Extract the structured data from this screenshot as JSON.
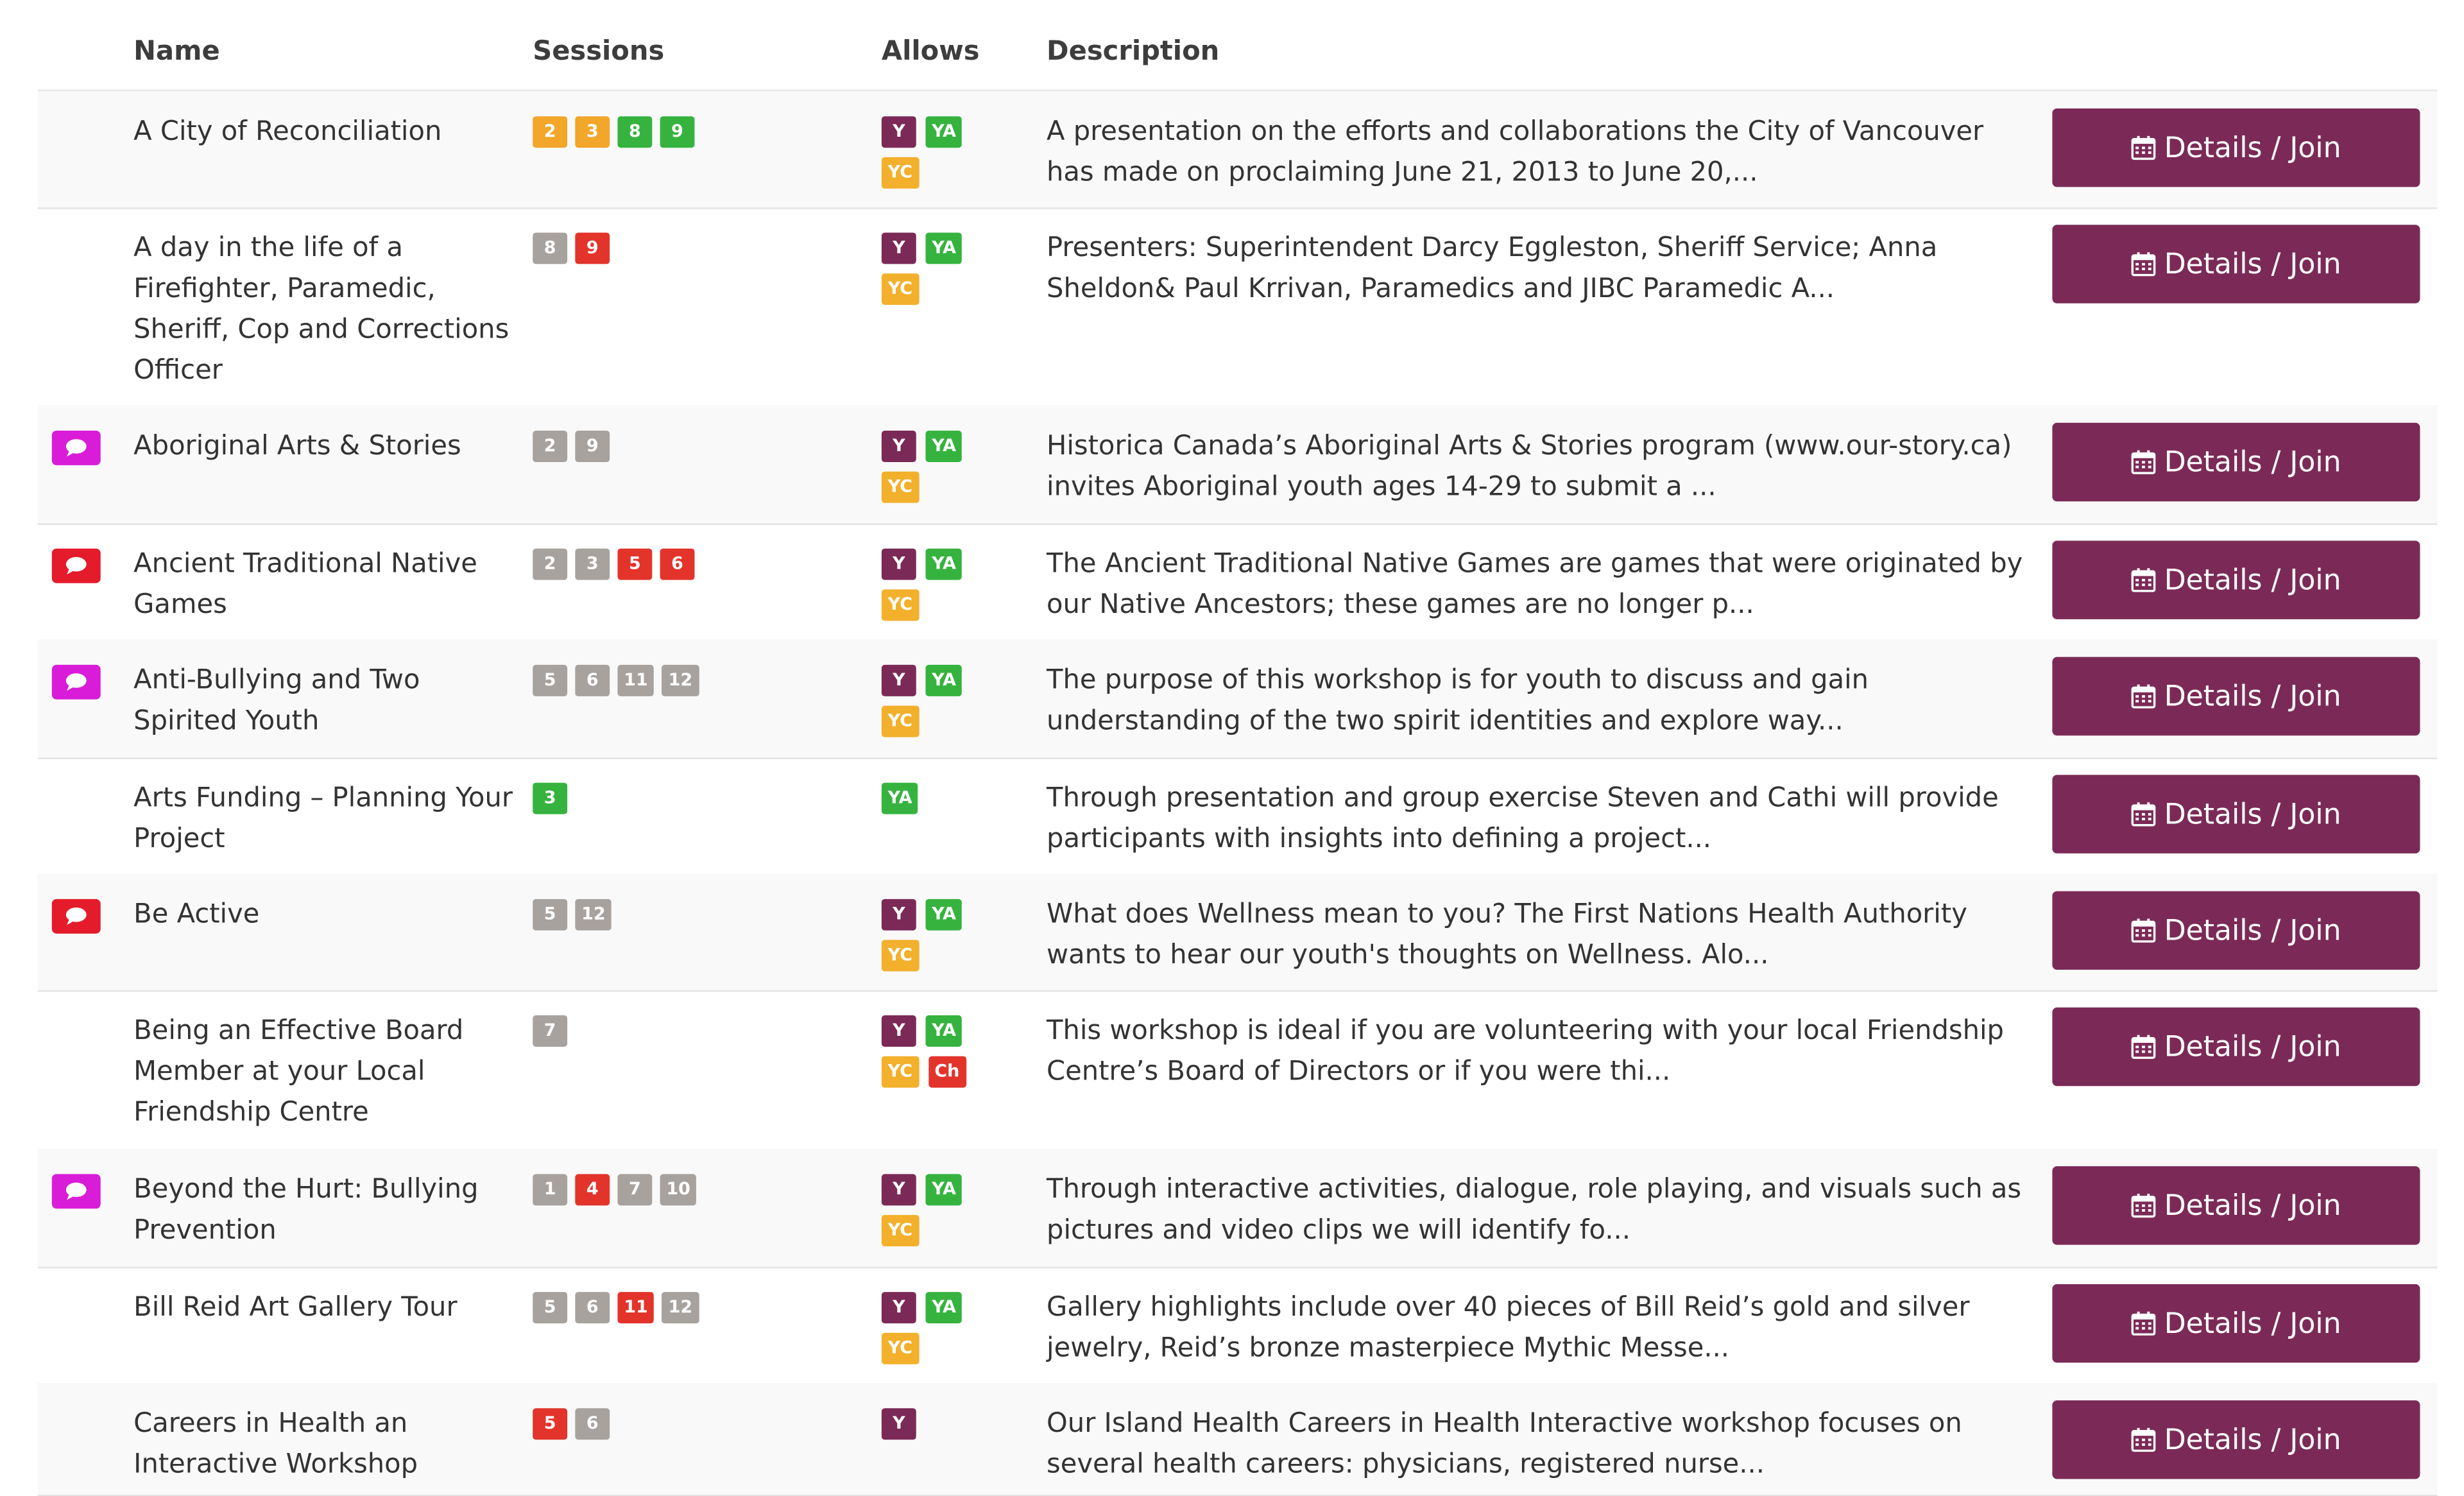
{
  "header": {
    "name": "Name",
    "sessions": "Sessions",
    "allows": "Allows",
    "description": "Description"
  },
  "colors": {
    "button": "#7b2a57",
    "comment_magenta": "#d81cd8",
    "comment_red": "#e41b2a",
    "badge_gray": "#a8a29e",
    "badge_orange": "#f2a62a",
    "badge_green": "#36b33f",
    "badge_red": "#e2342b",
    "allow_Y": "#7b2a57",
    "allow_YA": "#36b33f",
    "allow_YC": "#f2b02c",
    "allow_Ch": "#e2342b"
  },
  "button_label": "Details / Join",
  "rows": [
    {
      "name": "A City of Reconciliation",
      "comment": null,
      "sessions": [
        {
          "n": "2",
          "c": "orange"
        },
        {
          "n": "3",
          "c": "orange"
        },
        {
          "n": "8",
          "c": "green"
        },
        {
          "n": "9",
          "c": "green"
        }
      ],
      "allows": [
        [
          "Y",
          "YA"
        ],
        [
          "YC"
        ]
      ],
      "description": "A presentation on the efforts and collaborations the City of Vancouver has made on proclaiming June 21, 2013 to June 20,..."
    },
    {
      "name": "A day in the life of a Firefighter, Paramedic, Sheriff, Cop and Corrections Officer",
      "comment": null,
      "sessions": [
        {
          "n": "8",
          "c": "gray"
        },
        {
          "n": "9",
          "c": "red"
        }
      ],
      "allows": [
        [
          "Y",
          "YA"
        ],
        [
          "YC"
        ]
      ],
      "description": "Presenters: Superintendent Darcy Eggleston, Sheriff Service; Anna Sheldon& Paul Krrivan, Paramedics and JIBC Paramedic A..."
    },
    {
      "name": "Aboriginal Arts & Stories",
      "comment": "magenta",
      "sessions": [
        {
          "n": "2",
          "c": "gray"
        },
        {
          "n": "9",
          "c": "gray"
        }
      ],
      "allows": [
        [
          "Y",
          "YA"
        ],
        [
          "YC"
        ]
      ],
      "description": "Historica Canada’s Aboriginal Arts & Stories program (www.our-story.ca) invites Aboriginal youth ages 14-29 to submit a ..."
    },
    {
      "name": "Ancient Traditional Native Games",
      "comment": "red",
      "sessions": [
        {
          "n": "2",
          "c": "gray"
        },
        {
          "n": "3",
          "c": "gray"
        },
        {
          "n": "5",
          "c": "red"
        },
        {
          "n": "6",
          "c": "red"
        }
      ],
      "allows": [
        [
          "Y",
          "YA"
        ],
        [
          "YC"
        ]
      ],
      "description": "The Ancient Traditional Native Games are games that were originated by our Native Ancestors; these games are no longer p..."
    },
    {
      "name": "Anti-Bullying and Two Spirited Youth",
      "comment": "magenta",
      "sessions": [
        {
          "n": "5",
          "c": "gray"
        },
        {
          "n": "6",
          "c": "gray"
        },
        {
          "n": "11",
          "c": "gray"
        },
        {
          "n": "12",
          "c": "gray"
        }
      ],
      "allows": [
        [
          "Y",
          "YA"
        ],
        [
          "YC"
        ]
      ],
      "description": "The purpose of this workshop is for youth to discuss and gain understanding of the two spirit identities and explore way..."
    },
    {
      "name": "Arts Funding – Planning Your Project",
      "comment": null,
      "sessions": [
        {
          "n": "3",
          "c": "green"
        }
      ],
      "allows": [
        [
          "YA"
        ]
      ],
      "description": "Through presentation and group exercise Steven and Cathi will provide participants with insights into defining a project..."
    },
    {
      "name": "Be Active",
      "comment": "red",
      "sessions": [
        {
          "n": "5",
          "c": "gray"
        },
        {
          "n": "12",
          "c": "gray"
        }
      ],
      "allows": [
        [
          "Y",
          "YA"
        ],
        [
          "YC"
        ]
      ],
      "description": "What does Wellness mean to you? The First Nations Health Authority wants to hear our youth's thoughts on Wellness. Alo..."
    },
    {
      "name": "Being an Effective Board Member at your Local Friendship Centre",
      "comment": null,
      "sessions": [
        {
          "n": "7",
          "c": "gray"
        }
      ],
      "allows": [
        [
          "Y",
          "YA"
        ],
        [
          "YC",
          "Ch"
        ]
      ],
      "description": "This workshop is ideal if you are volunteering with your local Friendship Centre’s Board of Directors or if you were thi..."
    },
    {
      "name": "Beyond the Hurt: Bullying Prevention",
      "comment": "magenta",
      "sessions": [
        {
          "n": "1",
          "c": "gray"
        },
        {
          "n": "4",
          "c": "red"
        },
        {
          "n": "7",
          "c": "gray"
        },
        {
          "n": "10",
          "c": "gray"
        }
      ],
      "allows": [
        [
          "Y",
          "YA"
        ],
        [
          "YC"
        ]
      ],
      "description": "Through interactive activities, dialogue, role playing, and visuals such as pictures and video clips we will identify fo..."
    },
    {
      "name": "Bill Reid Art Gallery Tour",
      "comment": null,
      "sessions": [
        {
          "n": "5",
          "c": "gray"
        },
        {
          "n": "6",
          "c": "gray"
        },
        {
          "n": "11",
          "c": "red"
        },
        {
          "n": "12",
          "c": "gray"
        }
      ],
      "allows": [
        [
          "Y",
          "YA"
        ],
        [
          "YC"
        ]
      ],
      "description": "Gallery highlights include over 40 pieces of Bill Reid’s gold and silver jewelry, Reid’s bronze masterpiece Mythic Messe..."
    },
    {
      "name": "Careers in Health an Interactive Workshop",
      "comment": null,
      "sessions": [
        {
          "n": "5",
          "c": "red"
        },
        {
          "n": "6",
          "c": "gray"
        }
      ],
      "allows": [
        [
          "Y"
        ]
      ],
      "description": "Our Island Health Careers in Health Interactive workshop focuses on several health careers: physicians, registered nurse..."
    }
  ]
}
